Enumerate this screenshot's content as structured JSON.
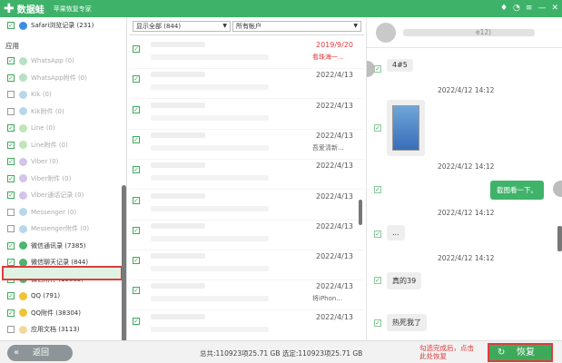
{
  "titlebar": {
    "logo": "数据蛙",
    "subtitle": "苹果恢复专家",
    "icons": [
      "diamond-icon",
      "chat-bubble-icon",
      "menu-icon",
      "minimize-icon",
      "close-icon"
    ]
  },
  "sidebar": {
    "top_item": "Safari浏览记录 (231)",
    "section": "应用",
    "items": [
      {
        "label": "WhatsApp (0)",
        "checked": true,
        "color": "#b8e0c4"
      },
      {
        "label": "WhatsApp附件 (0)",
        "checked": true,
        "color": "#b8e0c4"
      },
      {
        "label": "Kik (0)",
        "checked": false,
        "color": "#b9d7ec"
      },
      {
        "label": "Kik附件 (0)",
        "checked": false,
        "color": "#b9d7ec"
      },
      {
        "label": "Line (0)",
        "checked": true,
        "color": "#bfe5b8"
      },
      {
        "label": "Line附件 (0)",
        "checked": true,
        "color": "#bfe5b8"
      },
      {
        "label": "Viber (0)",
        "checked": true,
        "color": "#d2c4ea"
      },
      {
        "label": "Viber附件 (0)",
        "checked": true,
        "color": "#d2c4ea"
      },
      {
        "label": "Viber通话记录 (0)",
        "checked": true,
        "color": "#d2c4ea"
      },
      {
        "label": "Messenger (0)",
        "checked": false,
        "color": "#b9d7ec"
      },
      {
        "label": "Messenger附件 (0)",
        "checked": false,
        "color": "#b9d7ec"
      },
      {
        "label": "微信通讯录 (7385)",
        "checked": true,
        "color": "#4cb56e"
      },
      {
        "label": "微信聊天记录 (844)",
        "checked": true,
        "color": "#4cb56e"
      },
      {
        "label": "微信附件 (19863)",
        "checked": true,
        "color": "#4cb56e"
      },
      {
        "label": "QQ (791)",
        "checked": true,
        "color": "#f1c232"
      },
      {
        "label": "QQ附件 (38304)",
        "checked": true,
        "color": "#f1c232"
      },
      {
        "label": "应用文档 (3113)",
        "checked": false,
        "color": "#f1d9a0"
      }
    ]
  },
  "middle": {
    "filter1": "显示全部 (844)",
    "filter2": "所有帐户",
    "rows": [
      {
        "date": "2019/9/20",
        "sub": "看珠海一...",
        "red": true
      },
      {
        "date": "2022/4/13",
        "sub": "",
        "red": false
      },
      {
        "date": "2022/4/13",
        "sub": "",
        "red": false
      },
      {
        "date": "2022/4/13",
        "sub": "吾爱清新...",
        "red": false
      },
      {
        "date": "2022/4/13",
        "sub": "",
        "red": false
      },
      {
        "date": "2022/4/13",
        "sub": "",
        "red": false
      },
      {
        "date": "2022/4/13",
        "sub": "",
        "red": false
      },
      {
        "date": "2022/4/13",
        "sub": "",
        "red": false
      },
      {
        "date": "2022/4/13",
        "sub": "将iPhon...",
        "red": false
      },
      {
        "date": "2022/4/13",
        "sub": "",
        "red": false
      }
    ]
  },
  "chat": {
    "header_name_tail": "e12)",
    "times": [
      "2022/4/12 14:12",
      "2022/4/12 14:12",
      "2022/4/12 14:12",
      "2022/4/12 14:12"
    ],
    "bubble_top": "4#5",
    "bubble_screenshot": "截图看一下。",
    "bubble_dots": "...",
    "bubble_39": "真的39",
    "bubble_hot": "热死我了"
  },
  "bottom": {
    "back_label": "返回",
    "stats": "总共:110923项25.71 GB 选定:110923项25.71 GB",
    "hint_line1": "勾选完成后，点击",
    "hint_line2": "此处恢复",
    "recover_label": "恢复"
  },
  "colors": {
    "brand": "#3fb26a",
    "highlight": "#e03b3b"
  }
}
